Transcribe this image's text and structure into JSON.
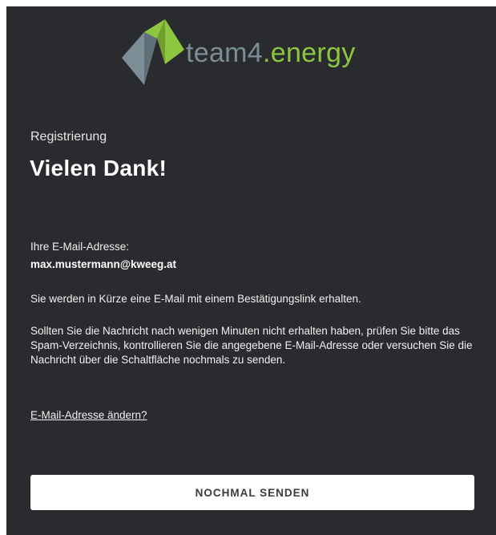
{
  "logo": {
    "text_part1": "team4",
    "text_part2": ".energy",
    "colors": {
      "grey": "#7b8e96",
      "green": "#8dc63f"
    }
  },
  "subtitle": "Registrierung",
  "headline": "Vielen Dank!",
  "email_label": "Ihre E-Mail-Adresse:",
  "email_value": "max.mustermann@kweeg.at",
  "info_text": "Sie werden in Kürze eine E-Mail mit einem Bestätigungslink erhalten.",
  "paragraph": "Sollten Sie die Nachricht nach wenigen Minuten nicht erhalten haben, prüfen Sie bitte das Spam-Verzeichnis, kontrollieren Sie die angegebene E-Mail-Adresse oder versuchen Sie die Nachricht über die Schaltfläche nochmals zu senden.",
  "change_link": "E-Mail-Adresse ändern?",
  "resend_button": "NOCHMAL SENDEN"
}
